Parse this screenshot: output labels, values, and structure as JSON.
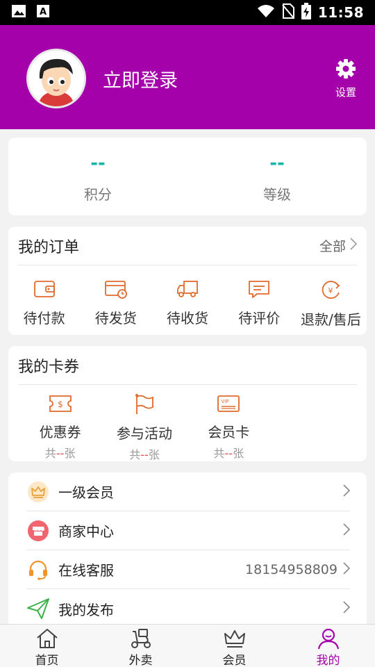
{
  "status_bar": {
    "time": "11:58"
  },
  "header": {
    "login_text": "立即登录",
    "settings_label": "设置",
    "background_color": "#a501ab"
  },
  "stats": [
    {
      "value": "--",
      "label": "积分"
    },
    {
      "value": "--",
      "label": "等级"
    }
  ],
  "orders": {
    "title": "我的订单",
    "more_label": "全部",
    "items": [
      {
        "label": "待付款",
        "icon": "wallet-icon"
      },
      {
        "label": "待发货",
        "icon": "card-clock-icon"
      },
      {
        "label": "待收货",
        "icon": "truck-icon"
      },
      {
        "label": "待评价",
        "icon": "comment-icon"
      },
      {
        "label": "退款/售后",
        "icon": "refund-icon"
      }
    ]
  },
  "coupons": {
    "title": "我的卡券",
    "items": [
      {
        "label": "优惠券",
        "prefix": "共",
        "count": "--",
        "suffix": "张",
        "icon": "coupon-icon"
      },
      {
        "label": "参与活动",
        "prefix": "共",
        "count": "--",
        "suffix": "张",
        "icon": "flag-icon"
      },
      {
        "label": "会员卡",
        "prefix": "共",
        "count": "--",
        "suffix": "张",
        "icon": "vip-card-icon"
      }
    ]
  },
  "menu": [
    {
      "label": "一级会员",
      "value": "",
      "icon": "crown-badge-icon"
    },
    {
      "label": "商家中心",
      "value": "",
      "icon": "store-icon"
    },
    {
      "label": "在线客服",
      "value": "18154958809",
      "icon": "headset-icon"
    },
    {
      "label": "我的发布",
      "value": "",
      "icon": "send-icon"
    }
  ],
  "bottom_nav": [
    {
      "label": "首页",
      "icon": "home-icon",
      "active": false
    },
    {
      "label": "外卖",
      "icon": "scooter-icon",
      "active": false
    },
    {
      "label": "会员",
      "icon": "crown-icon",
      "active": false
    },
    {
      "label": "我的",
      "icon": "user-icon",
      "active": true
    }
  ],
  "colors": {
    "accent": "#a501ab",
    "order_icon": "#e06a2c",
    "stat_value": "#1bb3a5"
  }
}
